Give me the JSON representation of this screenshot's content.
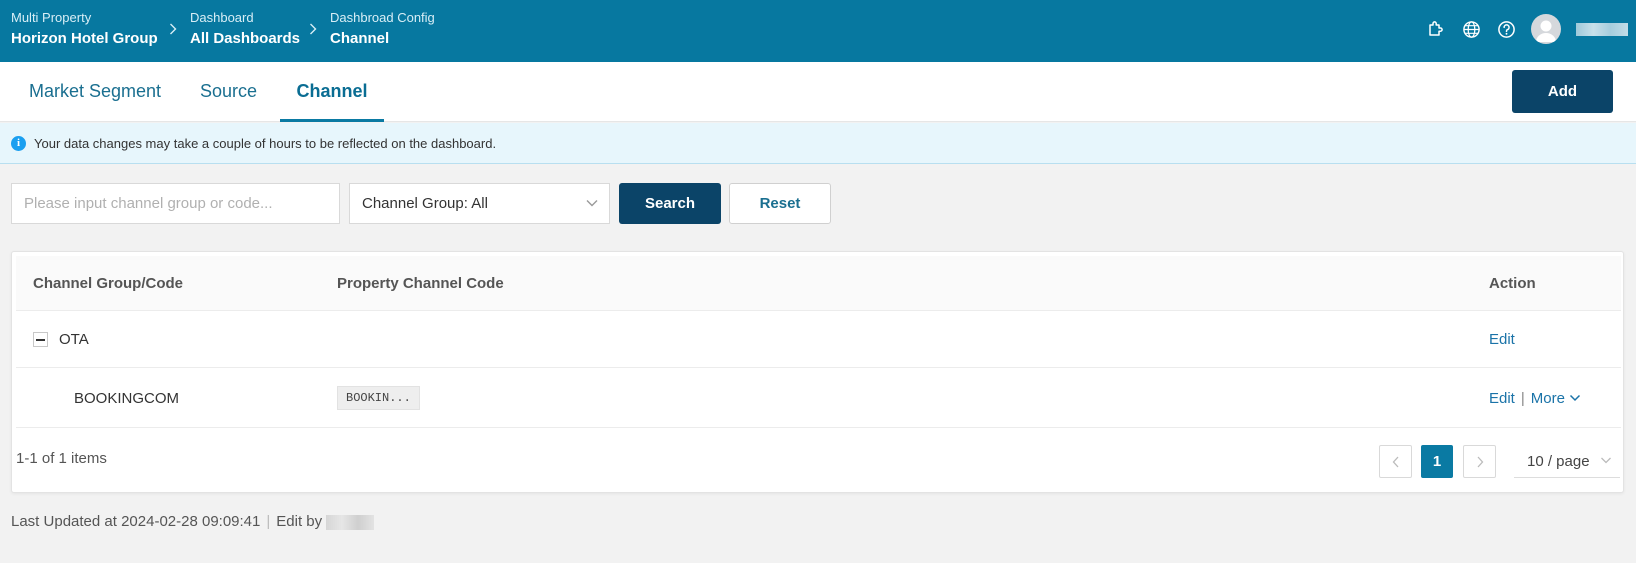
{
  "header": {
    "crumbs": [
      {
        "small": "Multi Property",
        "big": "Horizon Hotel Group"
      },
      {
        "small": "Dashboard",
        "big": "All Dashboards"
      },
      {
        "small": "Dashbroad Config",
        "big": "Channel"
      }
    ],
    "icons": [
      "extension-icon",
      "globe-icon",
      "help-icon",
      "avatar-icon"
    ]
  },
  "tabs": [
    {
      "label": "Market Segment",
      "active": false
    },
    {
      "label": "Source",
      "active": false
    },
    {
      "label": "Channel",
      "active": true
    }
  ],
  "add_label": "Add",
  "banner": {
    "text": "Your data changes may take a couple of hours to be reflected on the dashboard."
  },
  "filters": {
    "search_placeholder": "Please input channel group or code...",
    "channel_group_select": "Channel Group: All",
    "search_label": "Search",
    "reset_label": "Reset"
  },
  "table": {
    "columns": [
      "Channel Group/Code",
      "Property Channel Code",
      "Action"
    ],
    "rows": [
      {
        "group": "OTA",
        "expanded": true,
        "action": "Edit"
      },
      {
        "code": "BOOKINGCOM",
        "property_code": "BOOKIN...",
        "action_edit": "Edit",
        "action_more": "More"
      }
    ]
  },
  "pagination": {
    "info": "1-1 of 1 items",
    "current_page": "1",
    "page_size": "10 / page"
  },
  "footer": {
    "updated": "Last Updated at 2024-02-28 09:09:41",
    "edit_by": "Edit by"
  },
  "colors": {
    "header_bg": "#0778a0",
    "primary_button": "#0b4468",
    "link": "#1a73a8",
    "banner_bg": "#e7f6fc"
  }
}
